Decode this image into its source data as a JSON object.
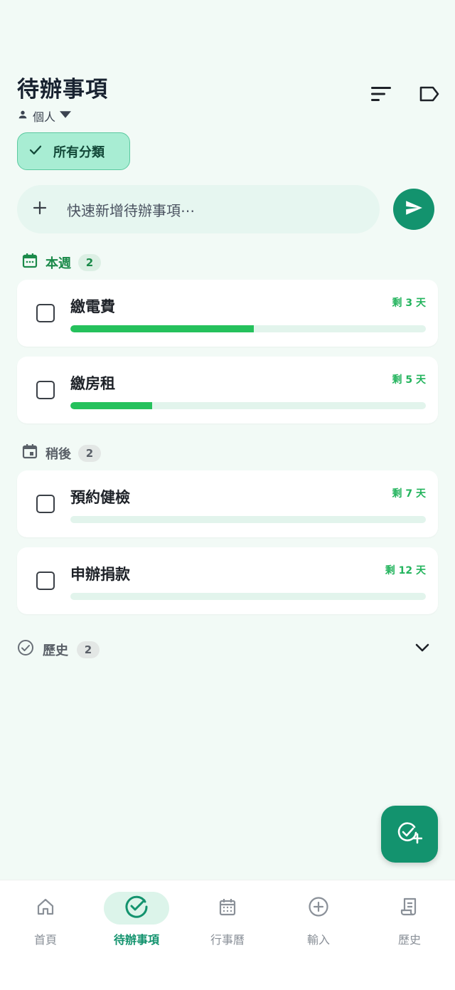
{
  "header": {
    "title": "待辦事項",
    "profile_label": "個人",
    "sort_icon": "sort-icon",
    "tag_icon": "tag-icon"
  },
  "filter_chip": {
    "label": "所有分類",
    "selected": true
  },
  "quick_add": {
    "placeholder": "快速新增待辦事項⋯"
  },
  "colors": {
    "accent": "#13936e",
    "progress": "#25c15c",
    "due_text": "#23b45d",
    "this_week_label": "#1b8a4a"
  },
  "sections": [
    {
      "label": "本週",
      "count": "2",
      "tasks": [
        {
          "name": "繳電費",
          "due": "剩 3 天",
          "progress": 0.515
        },
        {
          "name": "繳房租",
          "due": "剩 5 天",
          "progress": 0.23
        }
      ]
    },
    {
      "label": "稍後",
      "count": "2",
      "tasks": [
        {
          "name": "預約健檢",
          "due": "剩 7 天",
          "progress": 0
        },
        {
          "name": "申辦捐款",
          "due": "剩 12 天",
          "progress": 0
        }
      ]
    }
  ],
  "history": {
    "label": "歷史",
    "count": "2"
  },
  "fab_icon": "add-task-icon",
  "nav": [
    {
      "label": "首頁",
      "icon": "home-icon",
      "active": false
    },
    {
      "label": "待辦事項",
      "icon": "check-circle-icon",
      "active": true
    },
    {
      "label": "行事曆",
      "icon": "calendar-icon",
      "active": false
    },
    {
      "label": "輸入",
      "icon": "plus-circle-icon",
      "active": false
    },
    {
      "label": "歷史",
      "icon": "receipt-icon",
      "active": false
    }
  ]
}
